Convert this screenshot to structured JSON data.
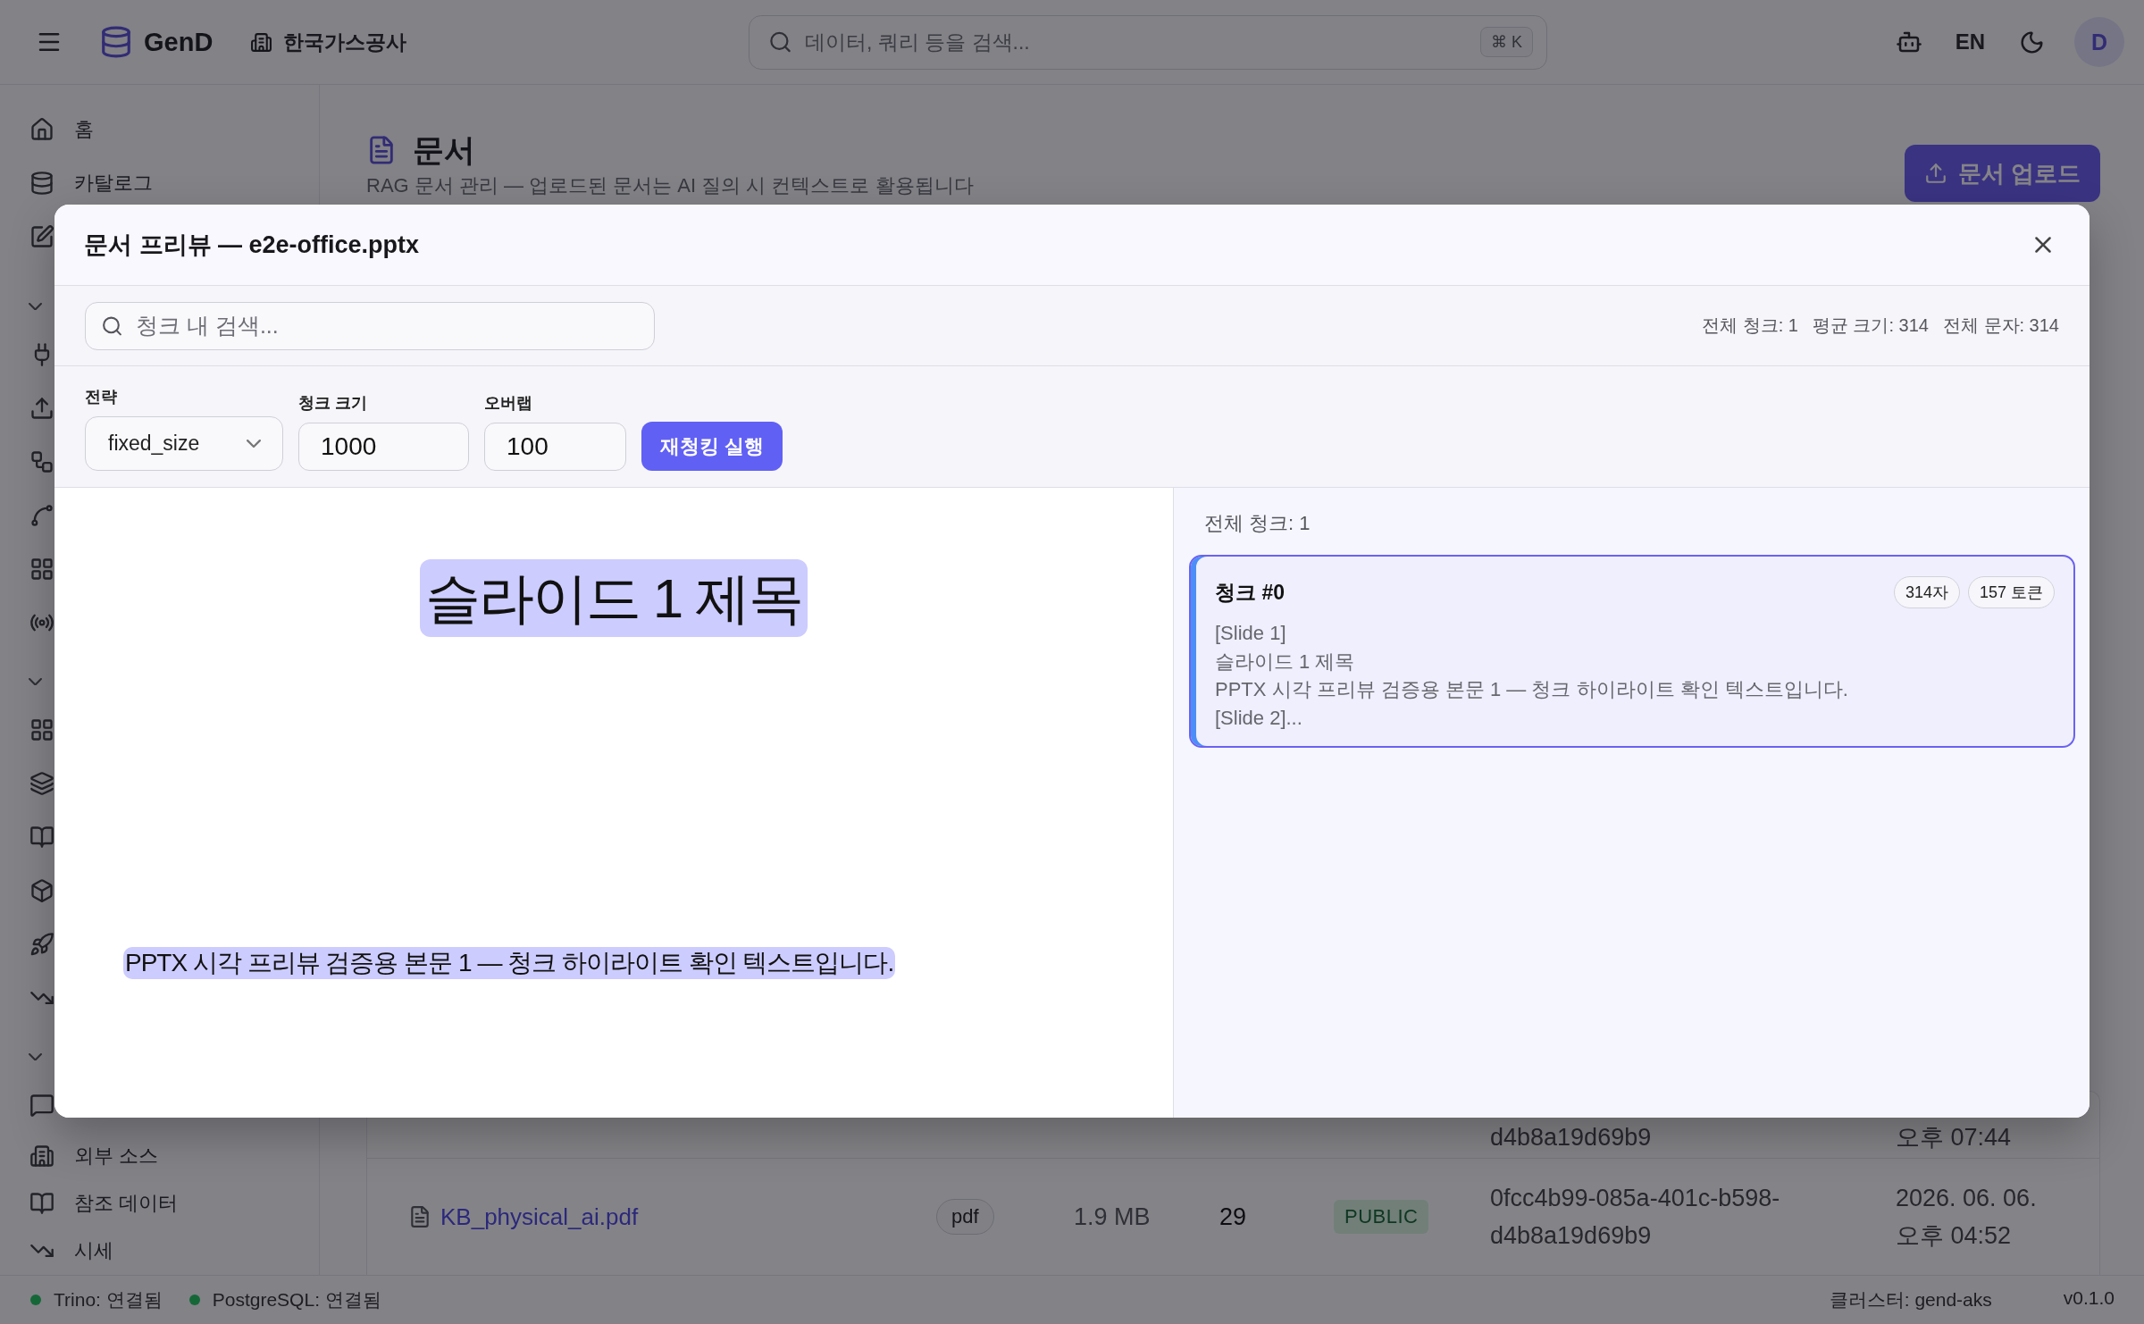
{
  "top_bar": {
    "brand": "GenD",
    "organization": "한국가스공사",
    "search": {
      "placeholder": "데이터, 쿼리 등을 검색...",
      "shortcut": "⌘ K"
    },
    "language": "EN",
    "avatar": "D"
  },
  "sidebar": {
    "items": [
      {
        "label": "홈"
      },
      {
        "label": "카탈로그"
      }
    ],
    "bottom_items": [
      {
        "label": "외부 소스"
      },
      {
        "label": "참조 데이터"
      },
      {
        "label": "시세"
      }
    ]
  },
  "page": {
    "title": "문서",
    "subtitle": "RAG 문서 관리 — 업로드된 문서는 AI 질의 시 컨텍스트로 활용됩니다",
    "upload_button": "문서 업로드"
  },
  "documents_table": {
    "rows": [
      {
        "column_6": "d4b8a19d69b9",
        "column_7": "오후 07:44"
      },
      {
        "column_1": "KB_physical_ai.pdf",
        "column_2": "pdf",
        "column_3": "1.9 MB",
        "column_4": "29",
        "column_5": "PUBLIC",
        "column_6": "0fcc4b99-085a-401c-b598-d4b8a19d69b9",
        "column_7": "2026. 06. 06. 오후 04:52"
      }
    ]
  },
  "preview_dialog": {
    "title": "문서 프리뷰 — e2e-office.pptx",
    "search": {
      "placeholder": "청크 내 검색..."
    },
    "stats": [
      "전체 청크: 1",
      "평균 크기: 314",
      "전체 문자: 314"
    ],
    "settings": {
      "strategy": {
        "label": "전략",
        "value": "fixed_size"
      },
      "chunk_size": {
        "label": "청크 크기",
        "value": "1000"
      },
      "overlap": {
        "label": "오버랩",
        "value": "100"
      },
      "rechunk_button": "재청킹 실행"
    },
    "slide": {
      "blocks": [
        {
          "kind": "title",
          "text": "슬라이드 1 제목",
          "highlighted": true
        },
        {
          "kind": "body",
          "text": "PPTX 시각 프리뷰 검증용 본문 1 — 청크 하이라이트 확인 텍스트입니다.",
          "highlighted": true
        }
      ]
    },
    "chunk_list": {
      "summary": "전체 청크: 1",
      "chunks": [
        {
          "title": "청크 #0",
          "badges": [
            "314자",
            "157 토큰"
          ],
          "content": "[Slide 1]\n슬라이드 1 제목\nPPTX 시각 프리뷰 검증용 본문 1 — 청크 하이라이트 확인 텍스트입니다.\n[Slide 2]...",
          "selected": true
        }
      ]
    }
  },
  "status_bar": {
    "connections": [
      {
        "label": "Trino: 연결됨",
        "connected": true
      },
      {
        "label": "PostgreSQL: 연결됨",
        "connected": true
      }
    ],
    "cluster": "클러스터: gend-aks",
    "version": "v0.1.0"
  }
}
